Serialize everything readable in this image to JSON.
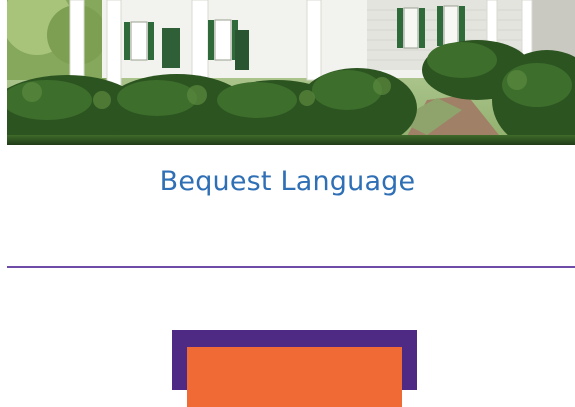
{
  "page": {
    "title": "Bequest Language",
    "hero_image": "historic-white-house-with-shrubs"
  },
  "colors": {
    "title": "#2e6fb5",
    "divider": "#6f4ba8",
    "promo_border": "#4e2a84",
    "promo_fill": "#f06a35"
  }
}
